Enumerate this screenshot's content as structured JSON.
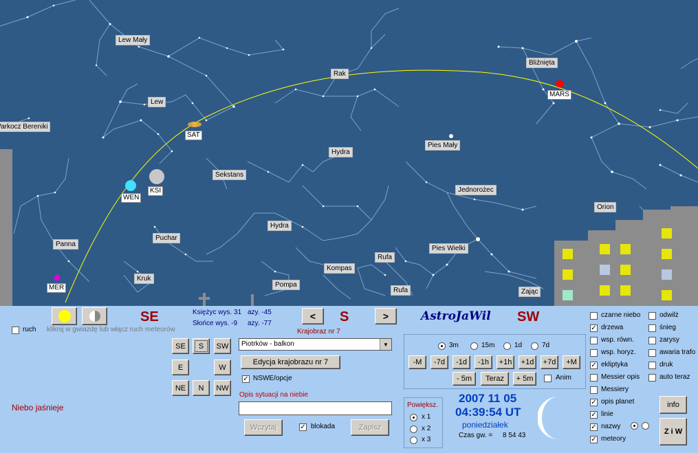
{
  "sky": {
    "constellations": [
      "Lew Mały",
      "Lew",
      "Warkocz Bereniki",
      "Rak",
      "Bliźnięta",
      "Hydra",
      "Pies Mały",
      "Sekstans",
      "Jednorożec",
      "Orion",
      "Hydra",
      "Puchar",
      "Panna",
      "Kompas",
      "Rufa",
      "Pies Wielki",
      "Kruk",
      "Pompa",
      "Rufa",
      "Zając"
    ],
    "planets": [
      "SAT",
      "KSI",
      "WEN",
      "MER",
      "MARS"
    ]
  },
  "panel": {
    "ruch_label": "ruch",
    "meteor_hint": "kliknij w gwiazdę lub włącz ruch meteorów",
    "dir_left": "SE",
    "moon_info": "Księżyc wys. 31",
    "moon_az": "azy. -45",
    "sun_info": "Słońce wys. -9",
    "sun_az": "azy. -77",
    "prev_btn": "<",
    "dir_center": "S",
    "next_btn": ">",
    "app_title": "AstroJaWil",
    "dir_right": "SW",
    "landscape_no": "Krajobraz nr 7",
    "compass": [
      "SE",
      "S",
      "SW",
      "E",
      "W",
      "NE",
      "N",
      "NW"
    ],
    "location_select": "Piotrków - balkon",
    "edit_landscape_btn": "Edycja krajobrazu nr 7",
    "nswe_label": "NSWE/opcje",
    "sky_desc_label": "Opis sytuacji na niebie",
    "sky_desc_value": "",
    "load_btn": "Wczytaj",
    "lock_label": "blokada",
    "save_btn": "Zapisz",
    "status_text": "Niebo jaśnieje",
    "step_options": [
      "3m",
      "15m",
      "1d",
      "7d"
    ],
    "time_buttons_row1": [
      "-M",
      "-7d",
      "-1d",
      "-1h",
      "+1h",
      "+1d",
      "+7d",
      "+M"
    ],
    "minus5": "- 5m",
    "now_btn": "Teraz",
    "plus5": "+ 5m",
    "anim_label": "Anim",
    "zoom_title": "Powiększ.",
    "zoom_options": [
      "x 1",
      "x 2",
      "x 3"
    ],
    "date": "2007 11 05",
    "time": "04:39:54 UT",
    "weekday": "poniedziałek",
    "sidereal_label": "Czas gw. =",
    "sidereal_value": "8 54 43",
    "options_col1": [
      {
        "label": "czarne niebo",
        "checked": false
      },
      {
        "label": "drzewa",
        "checked": true
      },
      {
        "label": "wsp. równ.",
        "checked": false
      },
      {
        "label": "wsp. horyz.",
        "checked": false
      },
      {
        "label": "ekliptyka",
        "checked": true
      },
      {
        "label": "Messier opis",
        "checked": false
      },
      {
        "label": "Messiery",
        "checked": false
      },
      {
        "label": "opis planet",
        "checked": true
      },
      {
        "label": "linie",
        "checked": true
      },
      {
        "label": "nazwy",
        "checked": true
      },
      {
        "label": "meteory",
        "checked": true
      }
    ],
    "options_col2": [
      {
        "label": "odwilż",
        "checked": false
      },
      {
        "label": "śnieg",
        "checked": false
      },
      {
        "label": "zarysy",
        "checked": false
      },
      {
        "label": "awaria trafo",
        "checked": false
      },
      {
        "label": "druk",
        "checked": false
      },
      {
        "label": "auto teraz",
        "checked": false
      }
    ],
    "info_btn": "info",
    "ziw_btn": "Z i W"
  },
  "colors": {
    "sky": "#2f5a86",
    "panel": "#a9ccf2",
    "ecliptic": "#ffff00",
    "direction": "#a00000",
    "title": "#000080"
  }
}
